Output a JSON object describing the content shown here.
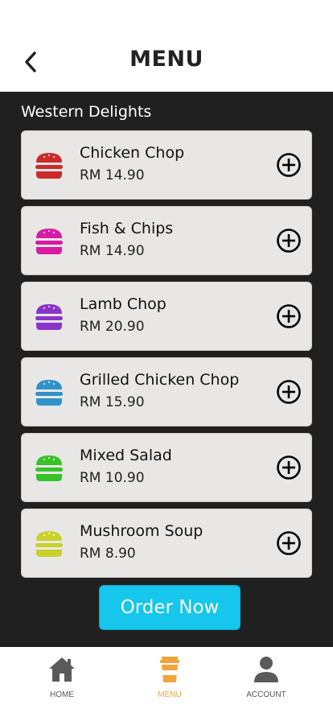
{
  "header": {
    "title": "MENU",
    "back_icon": "chevron-left-icon"
  },
  "menu": {
    "section_title": "Western Delights",
    "items": [
      {
        "name": "Chicken Chop",
        "price": "RM 14.90",
        "icon": "burger-icon",
        "color": "#cc2a2a"
      },
      {
        "name": "Fish & Chips",
        "price": "RM 14.90",
        "icon": "burger-icon",
        "color": "#d81aa5"
      },
      {
        "name": "Lamb Chop",
        "price": "RM 20.90",
        "icon": "burger-icon",
        "color": "#8a35c9"
      },
      {
        "name": "Grilled Chicken Chop",
        "price": "RM 15.90",
        "icon": "burger-icon",
        "color": "#2e93c8"
      },
      {
        "name": "Mixed Salad",
        "price": "RM 10.90",
        "icon": "burger-icon",
        "color": "#37c22a"
      },
      {
        "name": "Mushroom Soup",
        "price": "RM 8.90",
        "icon": "burger-icon",
        "color": "#c9d12a"
      }
    ],
    "add_icon": "plus-circle-icon"
  },
  "order_button": {
    "label": "Order Now",
    "color": "#16c6ec"
  },
  "tabbar": {
    "active_color": "#f2a33a",
    "inactive_color": "#555555",
    "tabs": [
      {
        "label": "HOME",
        "icon": "home-icon",
        "active": false
      },
      {
        "label": "MENU",
        "icon": "coffee-cup-icon",
        "active": true
      },
      {
        "label": "ACCOUNT",
        "icon": "user-icon",
        "active": false
      }
    ]
  }
}
